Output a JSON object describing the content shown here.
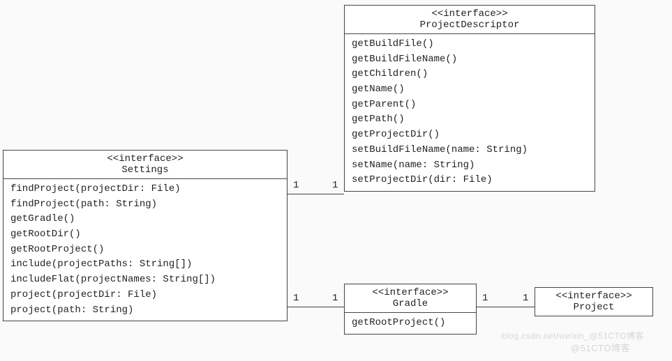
{
  "classes": {
    "settings": {
      "stereotype": "<<interface>>",
      "name": "Settings",
      "methods": [
        "findProject(projectDir: File)",
        "findProject(path: String)",
        "getGradle()",
        "getRootDir()",
        "getRootProject()",
        "include(projectPaths: String[])",
        "includeFlat(projectNames: String[])",
        "project(projectDir: File)",
        "project(path: String)"
      ]
    },
    "projectDescriptor": {
      "stereotype": "<<interface>>",
      "name": "ProjectDescriptor",
      "methods": [
        "getBuildFile()",
        "getBuildFileName()",
        "getChildren()",
        "getName()",
        "getParent()",
        "getPath()",
        "getProjectDir()",
        "setBuildFileName(name: String)",
        "setName(name: String)",
        "setProjectDir(dir: File)"
      ]
    },
    "gradle": {
      "stereotype": "<<interface>>",
      "name": "Gradle",
      "methods": [
        "getRootProject()"
      ]
    },
    "project": {
      "stereotype": "<<interface>>",
      "name": "Project",
      "methods": []
    }
  },
  "multiplicities": {
    "settings_pd_left": "1",
    "settings_pd_right": "1",
    "settings_gradle_left": "1",
    "settings_gradle_right": "1",
    "gradle_project_left": "1",
    "gradle_project_right": "1"
  },
  "watermarks": {
    "small": "blog.csdn.net/weixin_@51CTO博客",
    "main": "@51CTO博客"
  }
}
